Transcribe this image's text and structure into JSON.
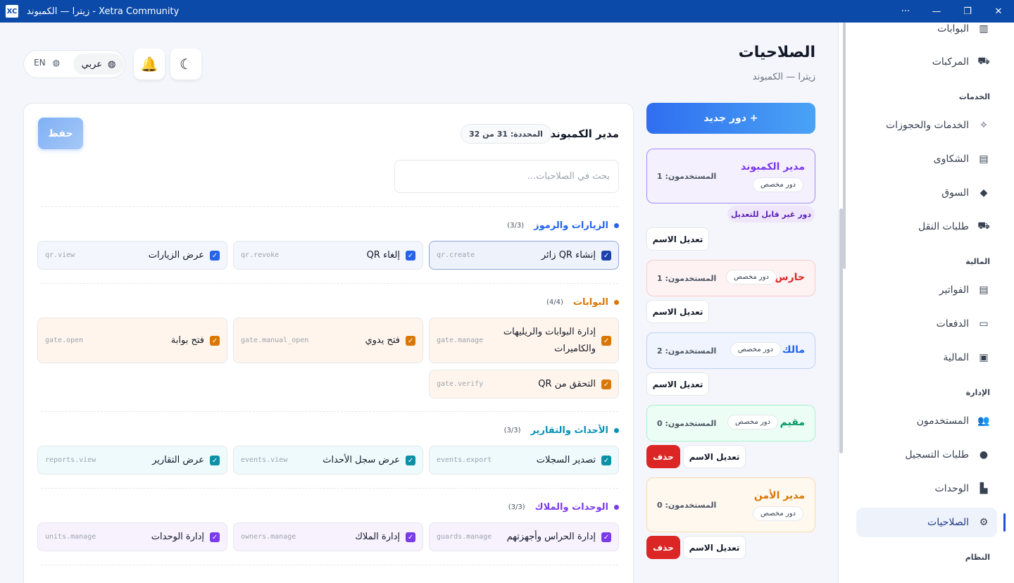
{
  "window": {
    "title": "زيترا — الكمبوند - Xetra Community",
    "logo": "XC",
    "controls": [
      "···",
      "—",
      "❐",
      "✕"
    ]
  },
  "header": {
    "title": "الصلاحيات",
    "subtitle": "زيترا — الكمبوند",
    "lang_ar": "عربي",
    "lang_en": "EN"
  },
  "sidebar": {
    "items": [
      {
        "label": "البوابات",
        "icon": "gate-icon"
      },
      {
        "label": "المركبات",
        "icon": "car-icon"
      },
      {
        "label": "الخدمات والحجوزات",
        "icon": "sparkle-icon"
      },
      {
        "label": "الشكاوى",
        "icon": "document-icon"
      },
      {
        "label": "السوق",
        "icon": "tag-icon"
      },
      {
        "label": "طلبات النقل",
        "icon": "truck-icon"
      },
      {
        "label": "الفواتير",
        "icon": "invoice-icon"
      },
      {
        "label": "الدفعات",
        "icon": "card-icon"
      },
      {
        "label": "المالية",
        "icon": "wallet-icon"
      },
      {
        "label": "المستخدمون",
        "icon": "users-icon"
      },
      {
        "label": "طلبات التسجيل",
        "icon": "alert-icon"
      },
      {
        "label": "الوحدات",
        "icon": "building-icon"
      },
      {
        "label": "الصلاحيات",
        "icon": "permission-icon"
      }
    ],
    "sections": [
      "الخدمات",
      "المالية",
      "الإدارة",
      "النظام"
    ]
  },
  "roles": {
    "new_role_label": "+ دور جديد",
    "noneditable_label": "دور غير قابل للتعديل",
    "rename_label": "تعديل الاسم",
    "delete_label": "حذف",
    "list": [
      {
        "name": "مدير الكمبوند",
        "users": "المستخدمون: 1",
        "tag": "دور مخصص",
        "color": "#7c3aed"
      },
      {
        "name": "حارس",
        "users": "المستخدمون: 1",
        "tag": "دور مخصص",
        "color": "#dc2626"
      },
      {
        "name": "مالك",
        "users": "المستخدمون: 2",
        "tag": "دور مخصص",
        "color": "#2563eb"
      },
      {
        "name": "مقيم",
        "users": "المستخدمون: 0",
        "tag": "دور مخصص",
        "color": "#059669"
      },
      {
        "name": "مدير الأمن",
        "users": "المستخدمون: 0",
        "tag": "دور مخصص",
        "color": "#d97706"
      }
    ]
  },
  "panel": {
    "title": "مدير الكمبوند",
    "count": "المحددة: 31 من 32",
    "save_label": "حفظ",
    "search_placeholder": "بحث في الصلاحيات...",
    "groups": [
      {
        "name": "الزيارات والرموز",
        "count": "(3/3)",
        "color": "#2563eb",
        "perms": [
          {
            "label": "إنشاء QR زائر",
            "code": "qr.create"
          },
          {
            "label": "إلغاء QR",
            "code": "qr.revoke"
          },
          {
            "label": "عرض الزيارات",
            "code": "qr.view"
          }
        ]
      },
      {
        "name": "البوابات",
        "count": "(4/4)",
        "color": "#d97706",
        "perms": [
          {
            "label": "إدارة البوابات والريليهات والكاميرات",
            "code": "gate.manage"
          },
          {
            "label": "فتح يدوي",
            "code": "gate.manual_open"
          },
          {
            "label": "فتح بوابة",
            "code": "gate.open"
          },
          {
            "label": "التحقق من QR",
            "code": "gate.verify"
          }
        ]
      },
      {
        "name": "الأحداث والتقارير",
        "count": "(3/3)",
        "color": "#0891b2",
        "perms": [
          {
            "label": "تصدير السجلات",
            "code": "events.export"
          },
          {
            "label": "عرض سجل الأحداث",
            "code": "events.view"
          },
          {
            "label": "عرض التقارير",
            "code": "reports.view"
          }
        ]
      },
      {
        "name": "الوحدات والملاك",
        "count": "(3/3)",
        "color": "#7c3aed",
        "perms": [
          {
            "label": "إدارة الحراس وأجهزتهم",
            "code": "guards.manage"
          },
          {
            "label": "إدارة الملاك",
            "code": "owners.manage"
          },
          {
            "label": "إدارة الوحدات",
            "code": "units.manage"
          }
        ]
      }
    ]
  }
}
